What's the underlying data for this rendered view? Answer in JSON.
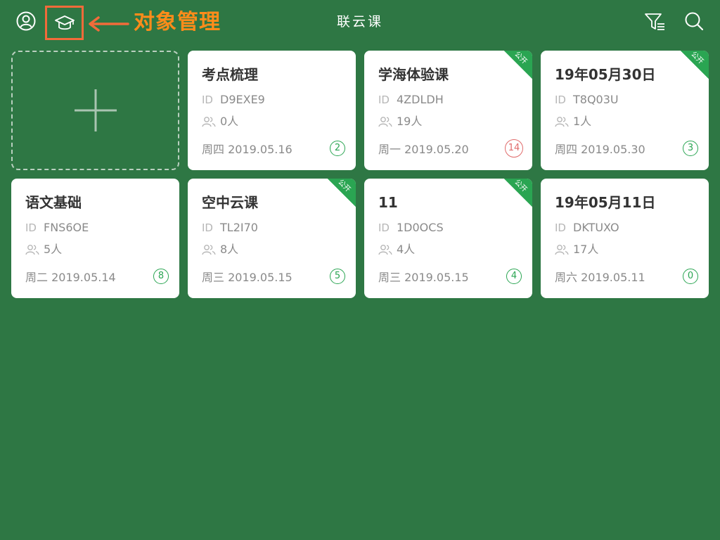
{
  "header": {
    "title": "联云课",
    "annotation": "对象管理",
    "user_icon": "user-circle-icon",
    "edu_icon": "graduation-cap-icon",
    "filter_icon": "filter-list-icon",
    "search_icon": "search-icon",
    "annotation_color": "#ff8c1a",
    "highlight_color": "#f26b3a"
  },
  "add_card": {
    "icon": "plus-icon"
  },
  "ribbon_label": "公开",
  "id_label": "ID",
  "colors": {
    "background": "#2e7744",
    "accent": "#2aa552",
    "alert": "#e06b6b"
  },
  "courses": [
    {
      "title": "考点梳理",
      "id": "D9EXE9",
      "people": "0人",
      "date": "周四 2019.05.16",
      "count": "2",
      "public": false,
      "alert": false
    },
    {
      "title": "学海体验课",
      "id": "4ZDLDH",
      "people": "19人",
      "date": "周一 2019.05.20",
      "count": "14",
      "public": true,
      "alert": true
    },
    {
      "title": "19年05月30日",
      "id": "T8Q03U",
      "people": "1人",
      "date": "周四 2019.05.30",
      "count": "3",
      "public": true,
      "alert": false
    },
    {
      "title": "语文基础",
      "id": "FNS6OE",
      "people": "5人",
      "date": "周二 2019.05.14",
      "count": "8",
      "public": false,
      "alert": false
    },
    {
      "title": "空中云课",
      "id": "TL2I70",
      "people": "8人",
      "date": "周三 2019.05.15",
      "count": "5",
      "public": true,
      "alert": false
    },
    {
      "title": "11",
      "id": "1D0OCS",
      "people": "4人",
      "date": "周三 2019.05.15",
      "count": "4",
      "public": true,
      "alert": false
    },
    {
      "title": "19年05月11日",
      "id": "DKTUXO",
      "people": "17人",
      "date": "周六 2019.05.11",
      "count": "0",
      "public": false,
      "alert": false
    }
  ]
}
